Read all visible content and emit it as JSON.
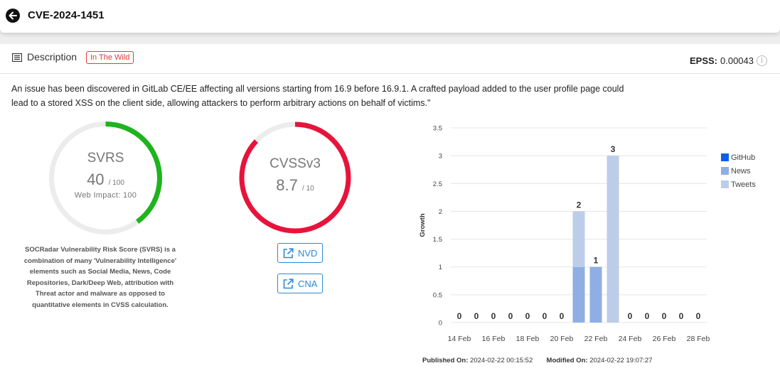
{
  "header": {
    "title": "CVE-2024-1451"
  },
  "description": {
    "title": "Description",
    "badge": "In The Wild",
    "epss_label": "EPSS:",
    "epss_value": "0.00043",
    "text": "An issue has been discovered in GitLab CE/EE affecting all versions starting from 16.9 before 16.9.1. A crafted payload added to the user profile page could lead to a stored XSS on the client side, allowing attackers to perform arbitrary actions on behalf of victims.\""
  },
  "svrs": {
    "label": "SVRS",
    "score": 40,
    "max": "/ 100",
    "impact": "Web Impact: 100",
    "color": "#1db41d",
    "note": "SOCRadar Vulnerability Risk Score (SVRS) is a combination of many 'Vulnerability Intelligence' elements such as Social Media, News, Code Repositories, Dark/Deep Web, attribution with Threat actor and malware as opposed to quantitative elements in CVSS calculation."
  },
  "cvss": {
    "label": "CVSSv3",
    "score": 8.7,
    "max": "/ 10",
    "color": "#e8133b"
  },
  "links": {
    "nvd": "NVD",
    "cna": "CNA"
  },
  "chart_data": {
    "type": "bar",
    "stacked": true,
    "ylabel": "Growth",
    "ylim": [
      0,
      3.5
    ],
    "yticks": [
      "0",
      "0.5",
      "1",
      "1.5",
      "2",
      "2.5",
      "3",
      "3.5"
    ],
    "x": [
      "14 Feb",
      "15 Feb",
      "16 Feb",
      "17 Feb",
      "18 Feb",
      "19 Feb",
      "20 Feb",
      "21 Feb",
      "22 Feb",
      "23 Feb",
      "24 Feb",
      "25 Feb",
      "26 Feb",
      "27 Feb",
      "28 Feb"
    ],
    "xtick_labels": [
      "14 Feb",
      "16 Feb",
      "18 Feb",
      "20 Feb",
      "22 Feb",
      "24 Feb",
      "26 Feb",
      "28 Feb"
    ],
    "series": [
      {
        "name": "GitHub",
        "color": "#0b61e6",
        "values": [
          0,
          0,
          0,
          0,
          0,
          0,
          0,
          0,
          0,
          0,
          0,
          0,
          0,
          0,
          0
        ]
      },
      {
        "name": "News",
        "color": "#8faee3",
        "values": [
          0,
          0,
          0,
          0,
          0,
          0,
          0,
          1,
          1,
          0,
          0,
          0,
          0,
          0,
          0
        ]
      },
      {
        "name": "Tweets",
        "color": "#bccde9",
        "values": [
          0,
          0,
          0,
          0,
          0,
          0,
          0,
          1,
          0,
          3,
          0,
          0,
          0,
          0,
          0
        ]
      }
    ],
    "totals": [
      "0",
      "0",
      "0",
      "0",
      "0",
      "0",
      "0",
      "2",
      "1",
      "3",
      "0",
      "0",
      "0",
      "0",
      "0"
    ],
    "grid": true,
    "legend": "right"
  },
  "footer": {
    "published_label": "Published On:",
    "published_value": "2024-02-22 00:15:52",
    "modified_label": "Modified On:",
    "modified_value": "2024-02-22 19:07:27"
  }
}
